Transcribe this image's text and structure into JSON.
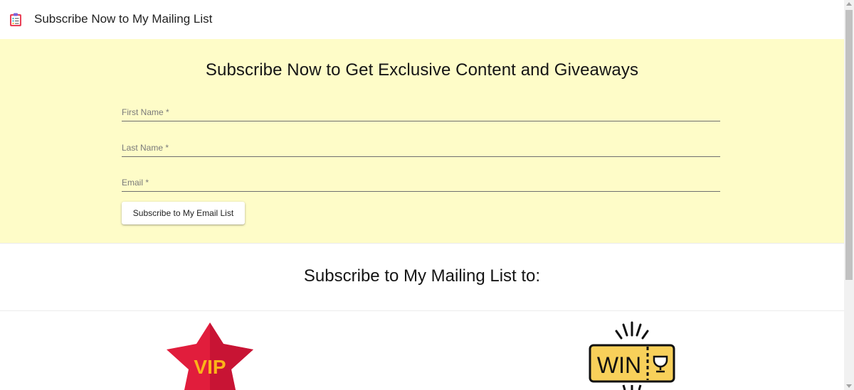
{
  "app": {
    "title": "Subscribe Now to My Mailing List",
    "icon": "clipboard-checklist-icon"
  },
  "hero": {
    "heading": "Subscribe Now to Get Exclusive Content and Giveaways",
    "background": "#fefcc8",
    "fields": {
      "first_name": {
        "placeholder": "First Name *",
        "value": ""
      },
      "last_name": {
        "placeholder": "Last Name *",
        "value": ""
      },
      "email": {
        "placeholder": "Email *",
        "value": ""
      }
    },
    "submit_label": "Subscribe to My Email List"
  },
  "benefits": {
    "heading": "Subscribe to My Mailing List to:",
    "items": [
      {
        "icon": "vip-star-icon",
        "text": "VIP"
      },
      {
        "icon": "win-ticket-icon",
        "text": "WIN"
      }
    ]
  }
}
